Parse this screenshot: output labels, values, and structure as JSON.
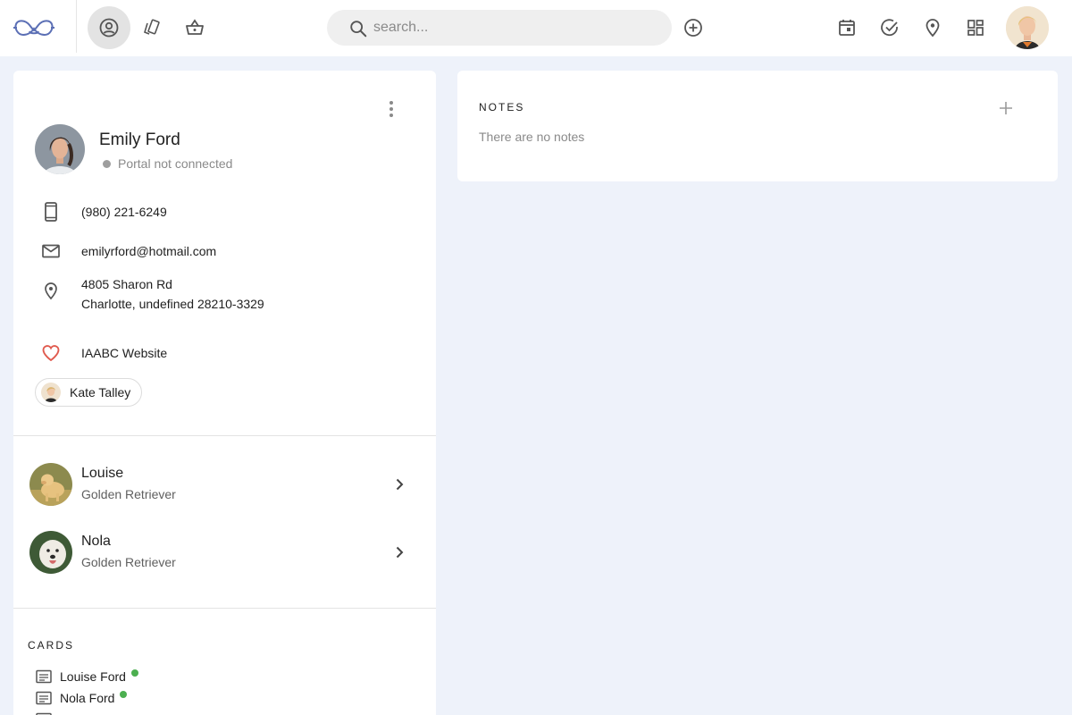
{
  "header": {
    "search_placeholder": "search...",
    "nav_icons": [
      "clients-icon",
      "tags-icon",
      "basket-icon"
    ],
    "right_icons": [
      "calendar-icon",
      "check-circle-icon",
      "location-pin-icon",
      "dashboard-icon"
    ]
  },
  "client": {
    "name": "Emily Ford",
    "portal_status": "Portal not connected",
    "phone": "(980) 221-6249",
    "email": "emilyrford@hotmail.com",
    "address_line1": "4805 Sharon Rd",
    "address_line2": "Charlotte, undefined 28210-3329",
    "referral_source": "IAABC Website",
    "assigned_staff": "Kate Talley"
  },
  "pets": [
    {
      "name": "Louise",
      "breed": "Golden Retriever"
    },
    {
      "name": "Nola",
      "breed": "Golden Retriever"
    }
  ],
  "cards": {
    "label": "CARDS",
    "items": [
      {
        "name": "Louise Ford",
        "status_color": "#4caf50"
      },
      {
        "name": "Nola Ford",
        "status_color": "#4caf50"
      }
    ]
  },
  "notes": {
    "label": "NOTES",
    "empty_text": "There are no notes"
  },
  "colors": {
    "background": "#eef2fa",
    "logo_color": "#5b6fb5",
    "heart_color": "#e05a4e",
    "status_green": "#4caf50"
  }
}
